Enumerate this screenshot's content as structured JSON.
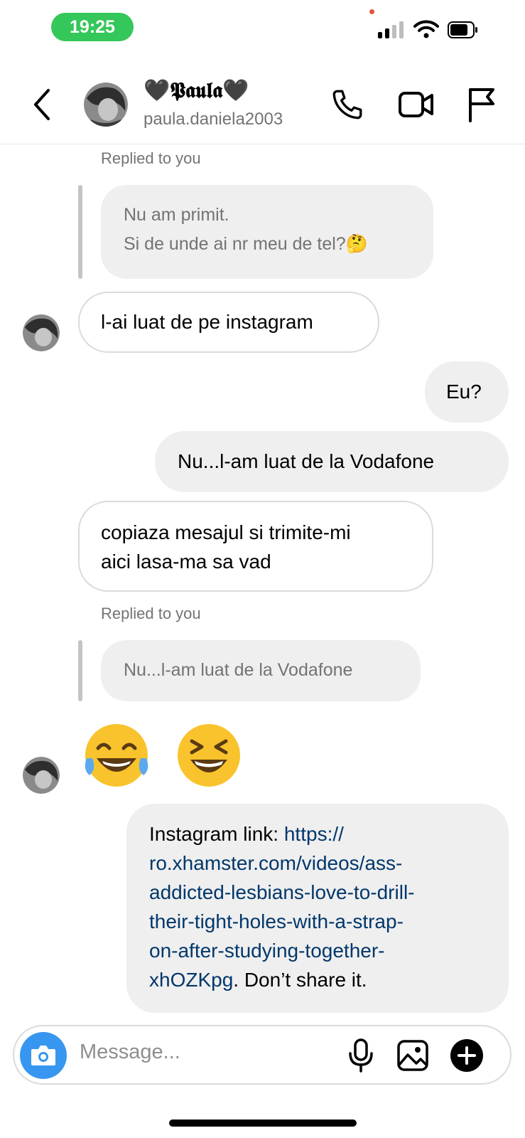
{
  "status_bar": {
    "time": "19:25"
  },
  "header": {
    "name": "🖤𝕻𝖆𝖚𝖑𝖆🖤",
    "username": "paula.daniela2003"
  },
  "messages": {
    "reply1_label": "Replied to you",
    "reply1_quote_line1": "Nu am primit.",
    "reply1_quote_line2": "Si de unde ai nr meu de tel?🤔",
    "msg1": "l-ai luat de pe instagram",
    "msg2": "Eu?",
    "msg3": "Nu...l-am luat de la Vodafone",
    "msg4_line1": "copiaza mesajul si trimite-mi",
    "msg4_line2": "aici lasa-ma sa vad",
    "reply2_label": "Replied to you",
    "reply2_quote": "Nu...l-am luat de la Vodafone",
    "emoji1": "😂",
    "emoji2": "😆",
    "msg5_prefix": "Instagram link: ",
    "msg5_link_1": "https://",
    "msg5_link_2": "ro.xhamster.com/videos/ass-",
    "msg5_link_3": "addicted-lesbians-love-to-drill-",
    "msg5_link_4": "their-tight-holes-with-a-strap-",
    "msg5_link_5": "on-after-studying-together-",
    "msg5_link_6": "xhOZKpg",
    "msg5_suffix": ". Don’t share it."
  },
  "composer": {
    "placeholder": "Message..."
  },
  "icons": {
    "back": "chevron-left-icon",
    "call": "phone-icon",
    "video": "video-camera-icon",
    "report": "flag-icon",
    "camera": "camera-icon",
    "mic": "microphone-icon",
    "gallery": "image-icon",
    "add": "plus-circle-icon"
  },
  "colors": {
    "time_pill": "#34c759",
    "link": "#00376b",
    "camera_button": "#3797f0",
    "bubble_gray": "#efefef"
  }
}
